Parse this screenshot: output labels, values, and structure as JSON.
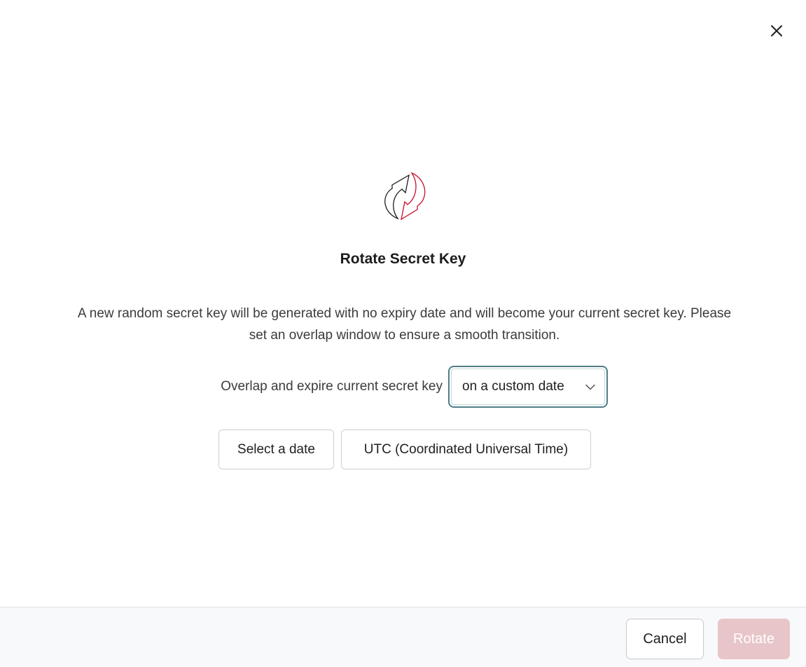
{
  "dialog": {
    "title": "Rotate Secret Key",
    "description": "A new random secret key will be generated with no expiry date and will become your current secret key. Please set an overlap window to ensure a smooth transition.",
    "close_icon": "close-icon",
    "hero_icon": "rotate-arrows-icon"
  },
  "overlap": {
    "label": "Overlap and expire current secret key",
    "selected_option": "on a custom date"
  },
  "date_picker": {
    "label": "Select a date"
  },
  "timezone": {
    "label": "UTC (Coordinated Universal Time)"
  },
  "footer": {
    "cancel_label": "Cancel",
    "rotate_label": "Rotate"
  },
  "colors": {
    "accent_border": "#4f7e86",
    "rotate_disabled": "#e8c5c8",
    "icon_red": "#c8102e"
  }
}
